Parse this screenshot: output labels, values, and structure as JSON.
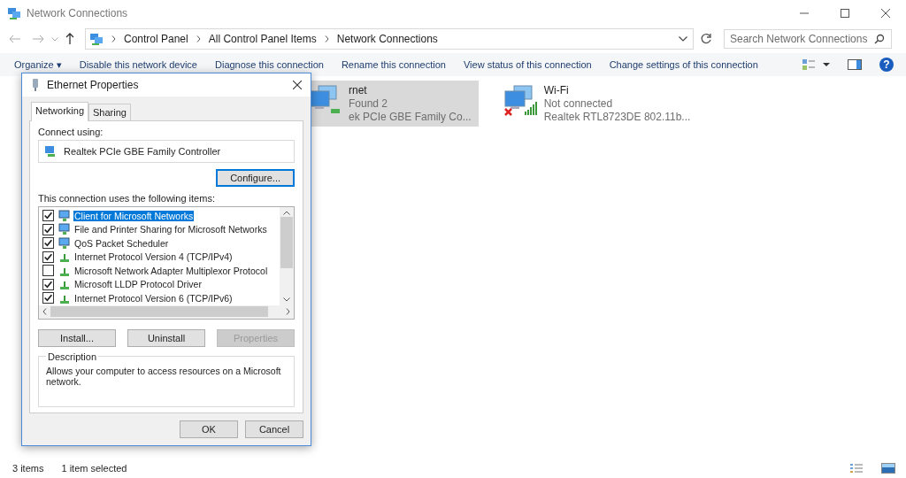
{
  "window": {
    "title": "Network Connections"
  },
  "breadcrumb": [
    "Control Panel",
    "All Control Panel Items",
    "Network Connections"
  ],
  "search": {
    "placeholder": "Search Network Connections"
  },
  "help": "?",
  "toolbar": [
    "Organize ▾",
    "Disable this network device",
    "Diagnose this connection",
    "Rename this connection",
    "View status of this connection",
    "Change settings of this connection"
  ],
  "connections": [
    {
      "name": "rnet",
      "status": "Found 2",
      "device": "ek PCIe GBE Family Co...",
      "selected": true,
      "connected": true
    },
    {
      "name": "Wi-Fi",
      "status": "Not connected",
      "device": "Realtek RTL8723DE 802.11b...",
      "selected": false,
      "connected": false
    }
  ],
  "status_bar": [
    "3 items",
    "1 item selected"
  ],
  "dialog": {
    "title": "Ethernet Properties",
    "tabs": [
      {
        "label": "Networking",
        "selected": true
      },
      {
        "label": "Sharing",
        "selected": false
      }
    ],
    "connect_label": "Connect using:",
    "adapter": "Realtek PCIe GBE Family Controller",
    "configure": "Configure...",
    "items_label": "This connection uses the following items:",
    "items": [
      {
        "label": "Client for Microsoft Networks",
        "kind": "client",
        "checked": true,
        "selected": true
      },
      {
        "label": "File and Printer Sharing for Microsoft Networks",
        "kind": "client",
        "checked": true,
        "selected": false
      },
      {
        "label": "QoS Packet Scheduler",
        "kind": "client",
        "checked": true,
        "selected": false
      },
      {
        "label": "Internet Protocol Version 4 (TCP/IPv4)",
        "kind": "protocol",
        "checked": true,
        "selected": false
      },
      {
        "label": "Microsoft Network Adapter Multiplexor Protocol",
        "kind": "protocol",
        "checked": false,
        "selected": false
      },
      {
        "label": "Microsoft LLDP Protocol Driver",
        "kind": "protocol",
        "checked": true,
        "selected": false
      },
      {
        "label": "Internet Protocol Version 6 (TCP/IPv6)",
        "kind": "protocol",
        "checked": true,
        "selected": false
      }
    ],
    "item_buttons": [
      {
        "label": "Install...",
        "disabled": false
      },
      {
        "label": "Uninstall",
        "disabled": false
      },
      {
        "label": "Properties",
        "disabled": true
      }
    ],
    "description_title": "Description",
    "description": "Allows your computer to access resources on a Microsoft network.",
    "buttons": [
      "OK",
      "Cancel"
    ]
  }
}
